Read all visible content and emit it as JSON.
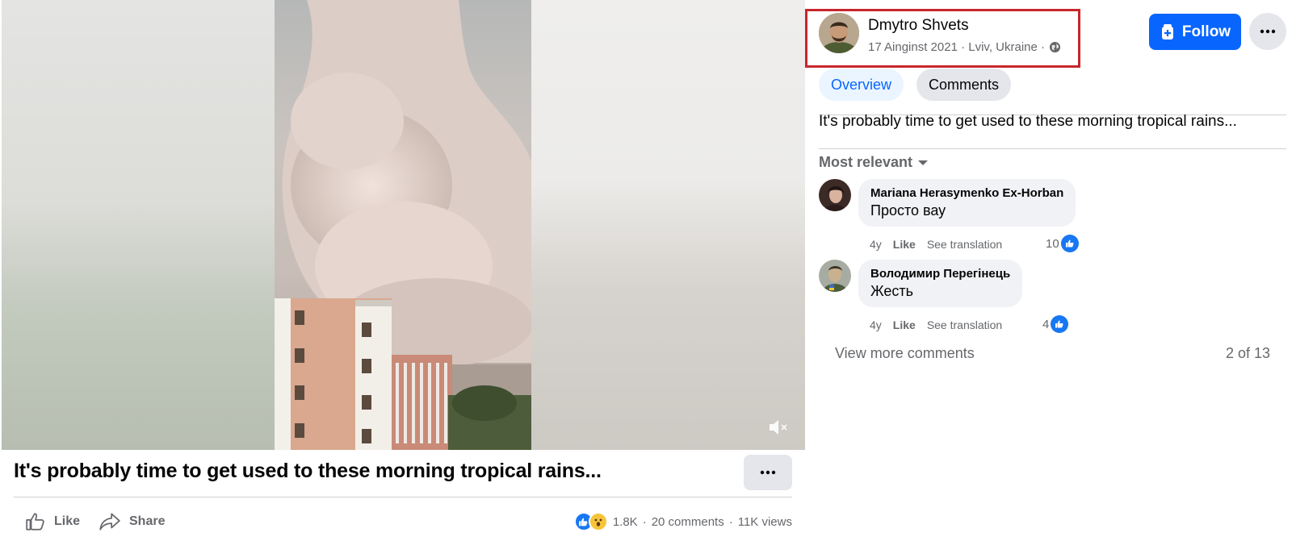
{
  "video": {
    "caption": "It's probably time to get used to these morning tropical rains..."
  },
  "actions": {
    "like_label": "Like",
    "share_label": "Share"
  },
  "stats": {
    "reactions_count": "1.8K",
    "separator": "·",
    "comments": "20 comments",
    "views": "11K views"
  },
  "post": {
    "author": "Dmytro Shvets",
    "meta": "17 Ainginst 2021 · Lviv, Ukraine ·",
    "follow_label": "Follow",
    "text": "It's probably time to get used to these morning tropical rains..."
  },
  "tabs": [
    {
      "label": "Overview",
      "active": true
    },
    {
      "label": "Comments",
      "active": false
    }
  ],
  "comments": {
    "sort_label": "Most relevant",
    "items": [
      {
        "name": "Mariana Herasymenko Ex-Horban",
        "text": "Просто вау",
        "age": "4y",
        "like": "Like",
        "translate": "See translation",
        "reactions": "10"
      },
      {
        "name": "Володимир Перегінець",
        "text": "Жесть",
        "age": "4y",
        "like": "Like",
        "translate": "See translation",
        "reactions": "4"
      }
    ],
    "view_more": "View more comments",
    "count": "2 of 13"
  },
  "colors": {
    "accent": "#0866ff",
    "highlight_box": "#c8262c",
    "muted_text": "#65676b"
  }
}
